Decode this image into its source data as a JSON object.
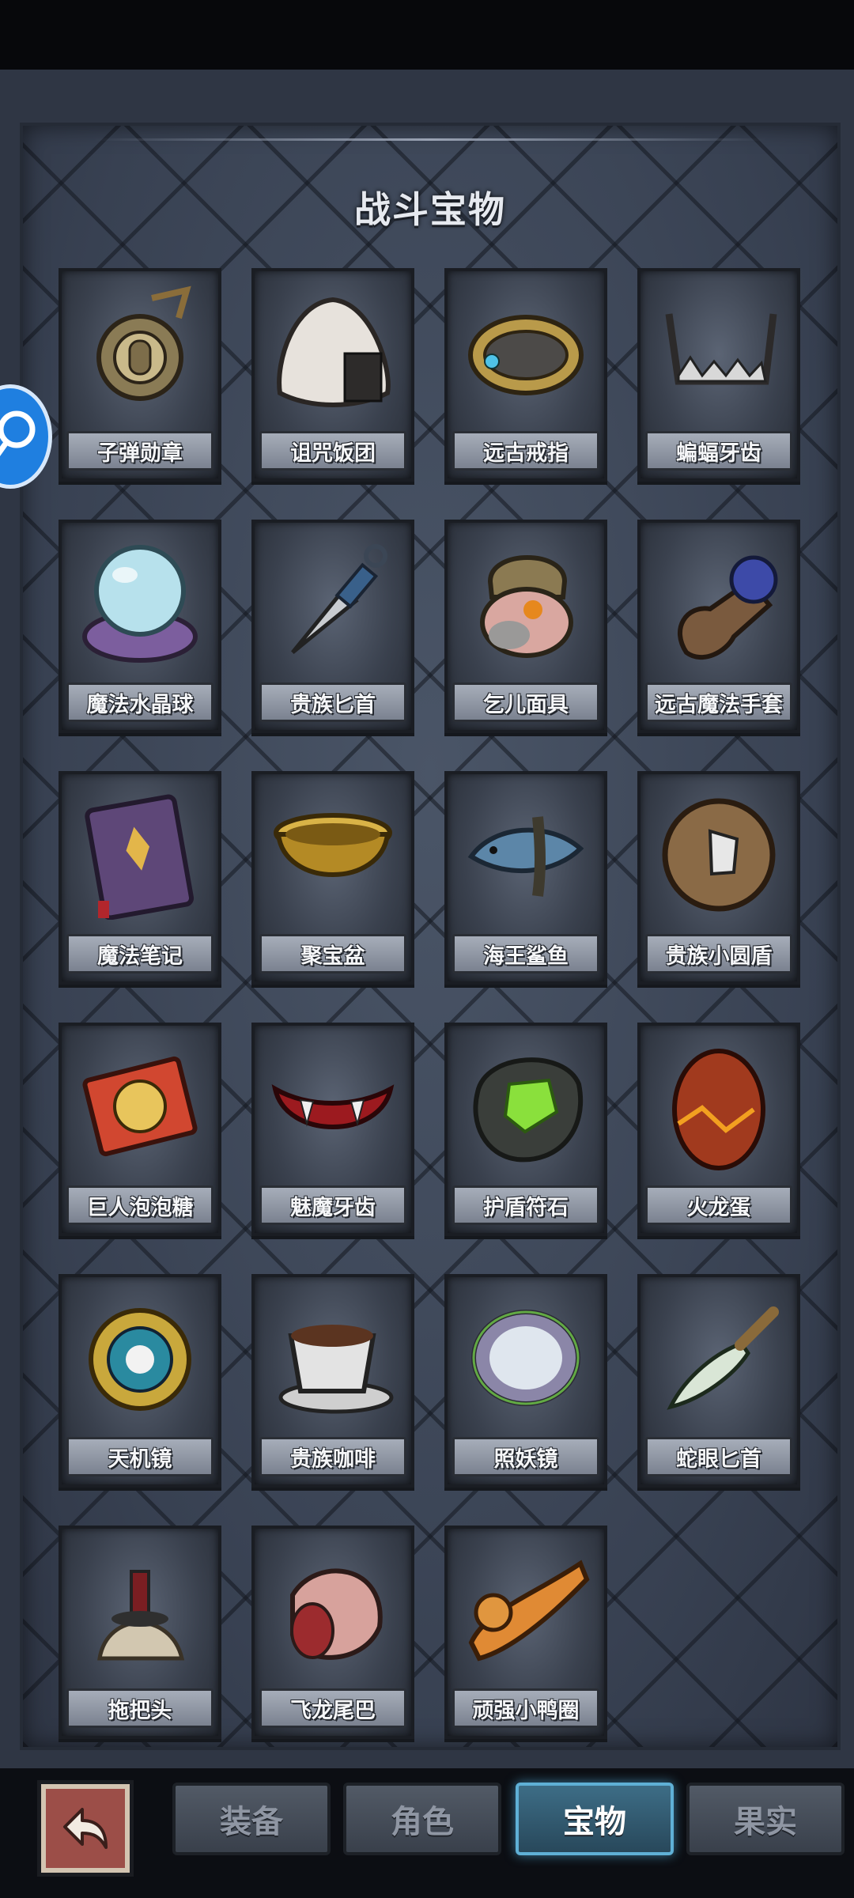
{
  "title": "战斗宝物",
  "items": [
    {
      "name": "子弹勋章",
      "icon": "medal-icon"
    },
    {
      "name": "诅咒饭团",
      "icon": "rice-ball-icon"
    },
    {
      "name": "远古戒指",
      "icon": "ring-icon"
    },
    {
      "name": "蝙蝠牙齿",
      "icon": "fang-icon"
    },
    {
      "name": "魔法水晶球",
      "icon": "crystal-ball-icon"
    },
    {
      "name": "贵族匕首",
      "icon": "dagger-icon"
    },
    {
      "name": "乞儿面具",
      "icon": "mask-icon"
    },
    {
      "name": "远古魔法手套",
      "icon": "gauntlet-icon"
    },
    {
      "name": "魔法笔记",
      "icon": "spellbook-icon"
    },
    {
      "name": "聚宝盆",
      "icon": "treasure-bowl-icon"
    },
    {
      "name": "海王鲨鱼",
      "icon": "shark-icon"
    },
    {
      "name": "贵族小圆盾",
      "icon": "round-shield-icon"
    },
    {
      "name": "巨人泡泡糖",
      "icon": "bubblegum-icon"
    },
    {
      "name": "魅魔牙齿",
      "icon": "lips-fang-icon"
    },
    {
      "name": "护盾符石",
      "icon": "rune-stone-icon"
    },
    {
      "name": "火龙蛋",
      "icon": "dragon-egg-icon"
    },
    {
      "name": "天机镜",
      "icon": "bagua-mirror-icon"
    },
    {
      "name": "贵族咖啡",
      "icon": "coffee-cup-icon"
    },
    {
      "name": "照妖镜",
      "icon": "magic-mirror-icon"
    },
    {
      "name": "蛇眼匕首",
      "icon": "snake-dagger-icon"
    },
    {
      "name": "拖把头",
      "icon": "mop-head-icon"
    },
    {
      "name": "飞龙尾巴",
      "icon": "dragon-tail-icon"
    },
    {
      "name": "顽强小鸭圈",
      "icon": "duck-ring-icon"
    }
  ],
  "tabs": [
    {
      "label": "装备",
      "active": false
    },
    {
      "label": "角色",
      "active": false
    },
    {
      "label": "宝物",
      "active": true
    },
    {
      "label": "果实",
      "active": false
    }
  ],
  "back_icon": "back-arrow-icon",
  "float_icon": "search-bubble-icon",
  "colors": {
    "accent_active_tab": "#5fb0d6",
    "back_button": "#9c4e48",
    "float_button": "#1f7fe0"
  }
}
